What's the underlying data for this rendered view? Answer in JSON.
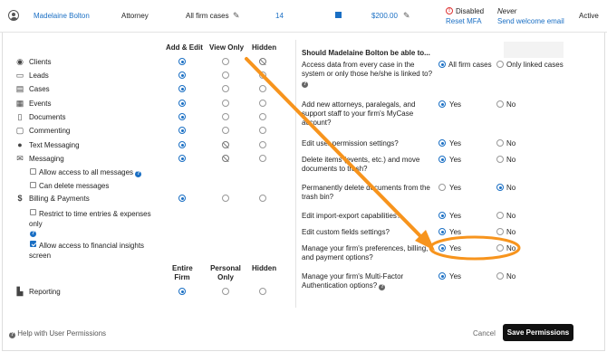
{
  "topbar": {
    "name": "Madelaine Bolton",
    "role": "Attorney",
    "case_access": "All firm cases",
    "number": "14",
    "rate": "$200.00",
    "mfa_status": "Disabled",
    "reset_mfa": "Reset MFA",
    "last_login": "Never",
    "welcome_email": "Send welcome email",
    "status": "Active"
  },
  "left": {
    "columns1": [
      "Add & Edit",
      "View Only",
      "Hidden"
    ],
    "rows": [
      {
        "label": "Clients"
      },
      {
        "label": "Leads"
      },
      {
        "label": "Cases"
      },
      {
        "label": "Events"
      },
      {
        "label": "Documents"
      },
      {
        "label": "Commenting"
      },
      {
        "label": "Text Messaging"
      },
      {
        "label": "Messaging"
      }
    ],
    "allow_all_messages": "Allow access to all messages",
    "can_delete_messages": "Can delete messages",
    "billing_label": "Billing & Payments",
    "restrict_time": "Restrict to time entries & expenses only",
    "allow_financial": "Allow access to financial insights screen",
    "columns2": [
      "Entire Firm",
      "Personal Only",
      "Hidden"
    ],
    "reporting": "Reporting"
  },
  "right": {
    "heading": "Should Madelaine Bolton be able to...",
    "q1": "Access data from every case in the system or only those he/she is linked to?",
    "q1_opt1": "All firm cases",
    "q1_opt2": "Only linked cases",
    "q2": "Add new attorneys, paralegals, and support staff to your firm's MyCase account?",
    "q3": "Edit user permission settings?",
    "q4": "Delete items (events, etc.) and move documents to trash?",
    "q5": "Permanently delete documents from the trash bin?",
    "q6": "Edit import-export capabilities?",
    "q7": "Edit custom fields settings?",
    "q8": "Manage your firm's preferences, billing, and payment options?",
    "q9": "Manage your firm's Multi-Factor Authentication options?",
    "yes": "Yes",
    "no": "No"
  },
  "footer": {
    "help": "Help with User Permissions",
    "cancel": "Cancel",
    "save": "Save Permissions"
  },
  "colors": {
    "accent": "#1a6fc4",
    "annotation": "#f7941d"
  }
}
